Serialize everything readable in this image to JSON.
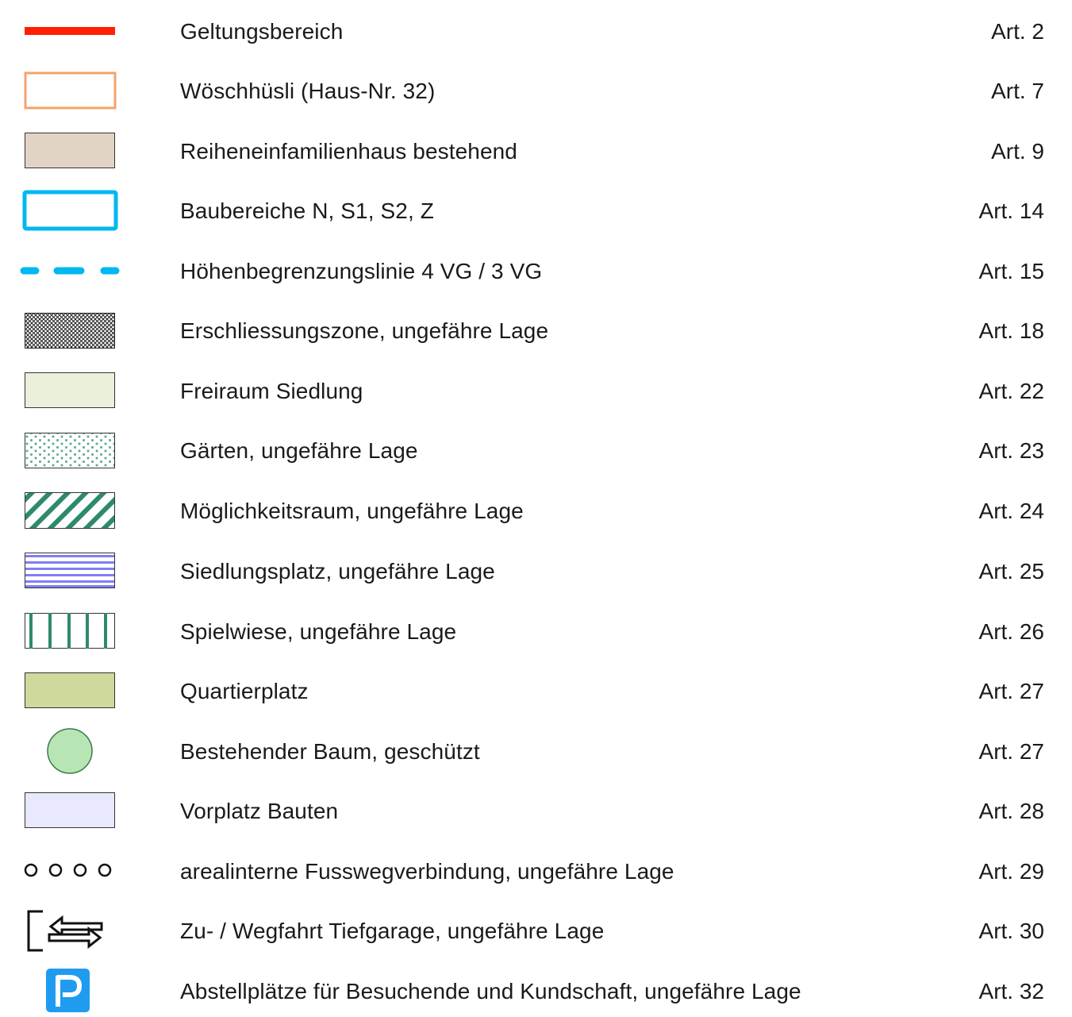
{
  "legend": {
    "items": [
      {
        "symbol": "red-line",
        "label": "Geltungsbereich",
        "article": "Art. 2"
      },
      {
        "symbol": "orange-outline-rect",
        "label": "Wöschhüsli (Haus-Nr. 32)",
        "article": "Art. 7"
      },
      {
        "symbol": "beige-filled-rect",
        "label": "Reiheneinfamilienhaus bestehend",
        "article": "Art. 9"
      },
      {
        "symbol": "cyan-outline-rect",
        "label": "Baubereiche N, S1, S2, Z",
        "article": "Art. 14"
      },
      {
        "symbol": "cyan-dashed-line",
        "label": "Höhenbegrenzungslinie 4 VG / 3 VG",
        "article": "Art. 15"
      },
      {
        "symbol": "crosshatch-rect",
        "label": "Erschliessungszone, ungefähre Lage",
        "article": "Art. 18"
      },
      {
        "symbol": "pale-green-rect",
        "label": "Freiraum Siedlung",
        "article": "Art. 22"
      },
      {
        "symbol": "dotted-rect",
        "label": "Gärten, ungefähre Lage",
        "article": "Art. 23"
      },
      {
        "symbol": "diagonal-hatch-rect",
        "label": "Möglichkeitsraum, ungefähre Lage",
        "article": "Art. 24"
      },
      {
        "symbol": "horizontal-stripes-rect",
        "label": "Siedlungsplatz, ungefähre Lage",
        "article": "Art. 25"
      },
      {
        "symbol": "vertical-bars-rect",
        "label": "Spielwiese, ungefähre Lage",
        "article": "Art. 26"
      },
      {
        "symbol": "olive-filled-rect",
        "label": "Quartierplatz",
        "article": "Art. 27"
      },
      {
        "symbol": "green-circle",
        "label": "Bestehender Baum, geschützt",
        "article": "Art. 27"
      },
      {
        "symbol": "lavender-filled-rect",
        "label": "Vorplatz Bauten",
        "article": "Art. 28"
      },
      {
        "symbol": "circle-chain",
        "label": "arealinterne Fusswegverbindung, ungefähre Lage",
        "article": "Art. 29"
      },
      {
        "symbol": "garage-arrows-icon",
        "label": "Zu- / Wegfahrt Tiefgarage, ungefähre Lage",
        "article": "Art. 30"
      },
      {
        "symbol": "parking-icon",
        "label": "Abstellplätze für Besuchende und Kundschaft, ungefähre Lage",
        "article": "Art. 32"
      }
    ]
  },
  "colors": {
    "red": "#ff2000",
    "orange": "#f4a36c",
    "beige": "#e2d4c4",
    "cyan": "#00b8f0",
    "pale_green": "#eaf0da",
    "teal": "#2f8a6a",
    "blue_stripe": "#7f7ff2",
    "olive": "#cfd99c",
    "tree_green": "#b7e6b4",
    "lavender": "#e8e8ff",
    "parking_blue": "#1f9cf0"
  }
}
